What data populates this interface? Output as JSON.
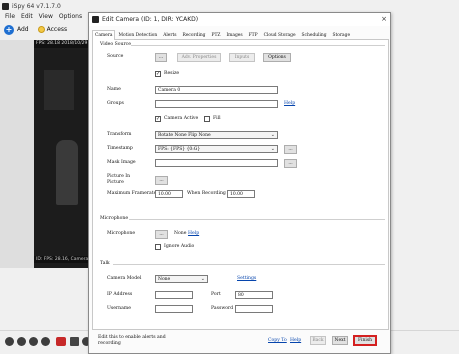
{
  "app": {
    "title": "iSpy 64 v7.1.7.0",
    "menu": [
      "File",
      "Edit",
      "View",
      "Options",
      "He"
    ],
    "toolbar": {
      "add_label": "Add",
      "access_label": "Access"
    },
    "camera_header": "FPS: 28.18 2018/10/29 1",
    "camera_footer": "ID: FPS: 28.16, Camera 0"
  },
  "dialog": {
    "title": "Edit Camera (ID: 1, DIR: YCAKD)",
    "close_symbol": "×",
    "tabs": [
      "Camera",
      "Motion Detection",
      "Alerts",
      "Recording",
      "PTZ",
      "Images",
      "FTP",
      "Cloud Storage",
      "Scheduling",
      "Storage"
    ],
    "active_tab": "Camera",
    "video_source": {
      "group_label": "Video Source",
      "source_label": "Source",
      "source_browse": "...",
      "adv_properties": "Adv. Properties",
      "inputs": "Inputs",
      "options": "Options",
      "resize_label": "Resize",
      "resize_checked": true,
      "name_label": "Name",
      "name_value": "Camera 0",
      "groups_label": "Groups",
      "groups_value": "",
      "groups_help": "Help",
      "camera_active_label": "Camera Active",
      "camera_active_checked": true,
      "fill_label": "Fill",
      "fill_checked": false,
      "transform_label": "Transform",
      "transform_value": "Rotate None Flip None",
      "timestamp_label": "Timestamp",
      "timestamp_value": "FPS: {FPS} {0:G}",
      "timestamp_btn": "...",
      "mask_image_label": "Mask Image",
      "mask_image_value": "",
      "mask_btn": "...",
      "pip_label_1": "Picture In",
      "pip_label_2": "Picture",
      "pip_btn": "...",
      "max_framerate_label": "Maximum Framerate",
      "max_framerate_value": "10.00",
      "when_recording_label": "When Recording",
      "when_recording_value": "10.00"
    },
    "microphone": {
      "group_label": "Microphone",
      "microphone_label": "Microphone",
      "browse": "...",
      "none_label": "None",
      "help": "Help",
      "ignore_audio_label": "Ignore Audio",
      "ignore_audio_checked": false
    },
    "talk": {
      "group_label": "Talk",
      "camera_model_label": "Camera Model",
      "camera_model_value": "None",
      "settings_link": "Settings",
      "ip_address_label": "IP Address",
      "ip_address_value": "",
      "port_label": "Port",
      "port_value": "80",
      "username_label": "Username",
      "username_value": "",
      "password_label": "Password",
      "password_value": ""
    },
    "footer": {
      "hint_line1": "Edit this to enable alerts and",
      "hint_line2": "recording",
      "copy_to": "Copy To",
      "help": "Help",
      "back": "Back",
      "next": "Next",
      "finish": "Finish"
    }
  },
  "colors": {
    "finish_highlight": "#d42020",
    "link": "#0645ad"
  }
}
